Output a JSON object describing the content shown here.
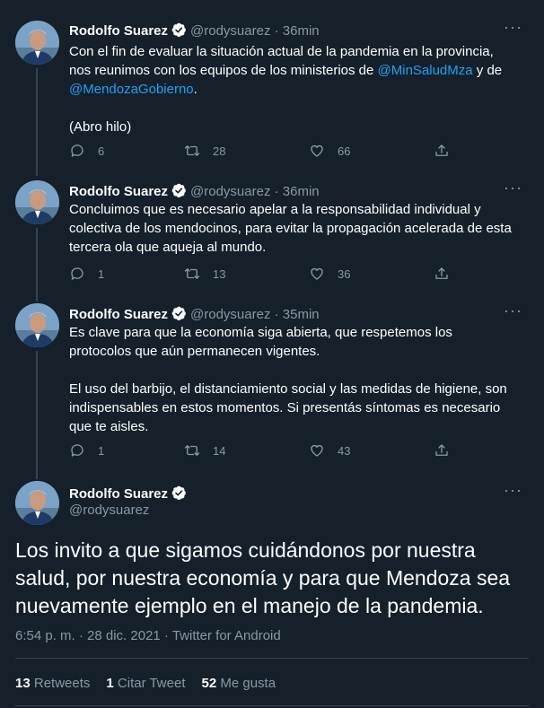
{
  "author": {
    "name": "Rodolfo Suarez",
    "handle": "@rodysuarez"
  },
  "tweets": [
    {
      "time": "36min",
      "text1": "Con el fin de evaluar la situación actual de la pandemia en la provincia, nos reunimos con los equipos de los ministerios de ",
      "mention1": "@MinSaludMza",
      "text2": " y de",
      "mention2": "@MendozaGobierno",
      "text3": ".",
      "text4": "(Abro hilo)",
      "replies": "6",
      "retweets": "28",
      "likes": "66"
    },
    {
      "time": "36min",
      "text": "Concluimos que es necesario apelar a la responsabilidad individual y colectiva de los mendocinos, para evitar la propagación acelerada de esta tercera ola que aqueja al mundo.",
      "replies": "1",
      "retweets": "13",
      "likes": "36"
    },
    {
      "time": "35min",
      "text1": "Es clave para que la economía siga abierta, que respetemos los protocolos que aún permanecen vigentes.",
      "text2": "El uso del barbijo, el distanciamiento social y las medidas de higiene, son indispensables en estos momentos. Si presentás síntomas es necesario que te aisles.",
      "replies": "1",
      "retweets": "14",
      "likes": "43"
    }
  ],
  "main": {
    "text": "Los invito a que sigamos cuidándonos por nuestra salud, por nuestra economía y para que Mendoza sea nuevamente ejemplo en el manejo de la pandemia.",
    "meta": "6:54 p. m. · 28 dic. 2021 · Twitter for Android",
    "retweets_count": "13",
    "retweets_label": "Retweets",
    "quotes_count": "1",
    "quotes_label": "Citar Tweet",
    "likes_count": "52",
    "likes_label": "Me gusta"
  },
  "icons": [
    "verified-badge-icon",
    "more-icon",
    "reply-icon",
    "retweet-icon",
    "like-icon",
    "share-icon"
  ],
  "colors": {
    "background": "#15202b",
    "secondary_text": "#8899a6",
    "link": "#1da1f2",
    "divider": "#38444d"
  }
}
